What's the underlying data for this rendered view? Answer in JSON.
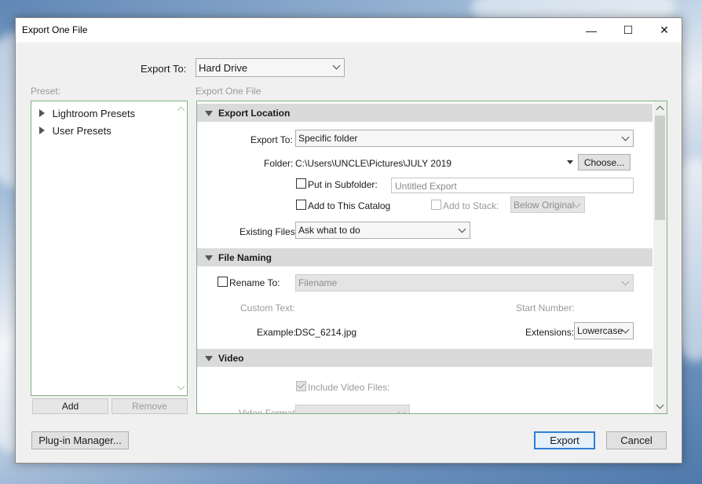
{
  "window": {
    "title": "Export One File"
  },
  "window_controls": {
    "minimize": "—",
    "maximize": "☐",
    "close": "✕"
  },
  "top": {
    "export_to_label": "Export To:",
    "export_to_value": "Hard Drive"
  },
  "preset": {
    "label": "Preset:",
    "items": [
      "Lightroom Presets",
      "User Presets"
    ],
    "add_label": "Add",
    "remove_label": "Remove"
  },
  "settings_header": "Export One File",
  "export_location": {
    "heading": "Export Location",
    "export_to_label": "Export To:",
    "export_to_value": "Specific folder",
    "folder_label": "Folder:",
    "folder_path": "C:\\Users\\UNCLE\\Pictures\\JULY 2019",
    "choose_label": "Choose...",
    "subfolder_label": "Put in Subfolder:",
    "subfolder_value": "Untitled Export",
    "add_catalog_label": "Add to This Catalog",
    "add_stack_label": "Add to Stack:",
    "stack_value": "Below Original",
    "existing_label": "Existing Files:",
    "existing_value": "Ask what to do"
  },
  "file_naming": {
    "heading": "File Naming",
    "rename_label": "Rename To:",
    "rename_value": "Filename",
    "custom_text_label": "Custom Text:",
    "start_number_label": "Start Number:",
    "example_label": "Example:",
    "example_value": "DSC_6214.jpg",
    "extensions_label": "Extensions:",
    "extensions_value": "Lowercase"
  },
  "video": {
    "heading": "Video",
    "include_label": "Include Video Files:",
    "format_label": "Video Format:"
  },
  "footer": {
    "plugin_label": "Plug-in Manager...",
    "export_label": "Export",
    "cancel_label": "Cancel"
  }
}
